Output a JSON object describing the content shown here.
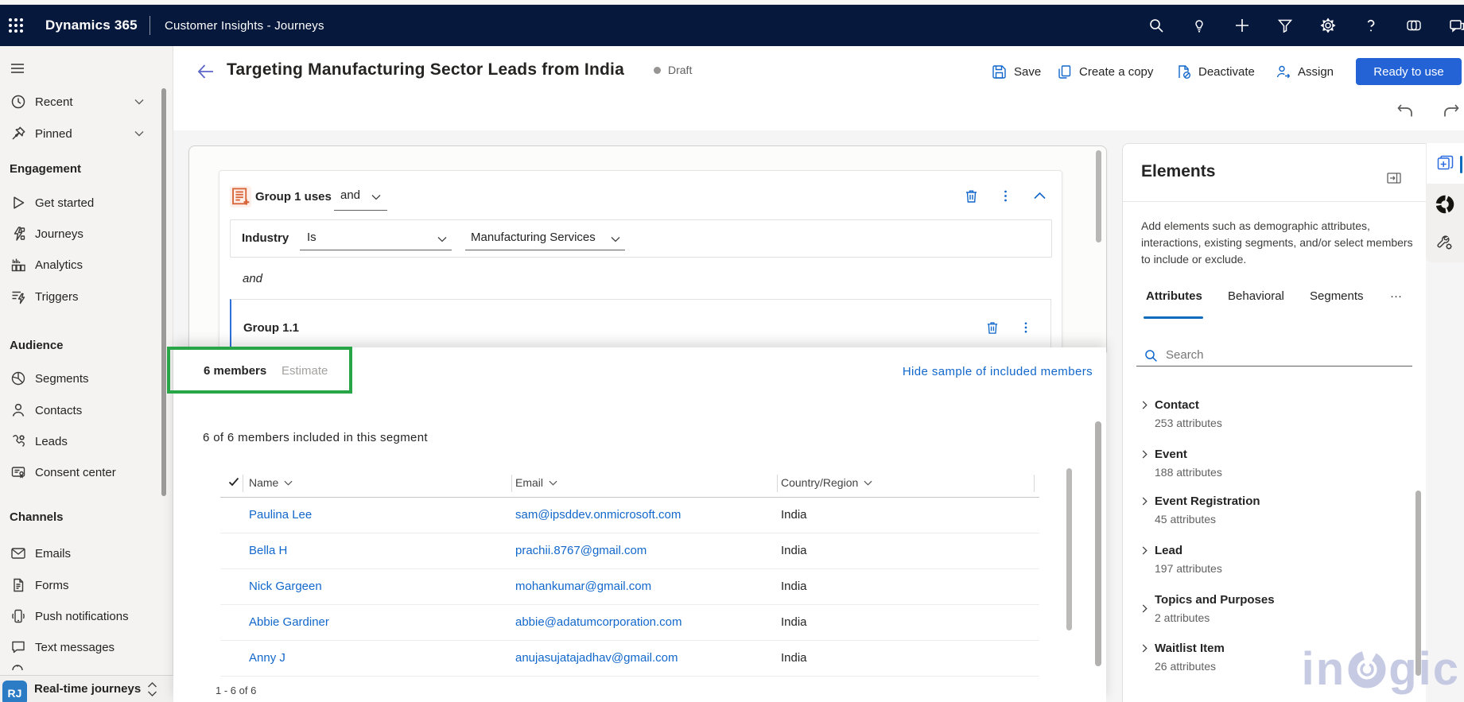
{
  "topbar": {
    "brand": "Dynamics 365",
    "app_name": "Customer Insights - Journeys",
    "icons": [
      "app-launcher-icon",
      "search-icon",
      "lightbulb-icon",
      "plus-icon",
      "filter-icon",
      "gear-icon",
      "help-icon",
      "copilot-icon",
      "feedback-icon"
    ]
  },
  "sidebar": {
    "collapse": "menu-icon",
    "top_items": [
      {
        "label": "Recent",
        "icon": "clock-icon"
      },
      {
        "label": "Pinned",
        "icon": "pin-icon"
      }
    ],
    "sections": [
      {
        "header": "Engagement",
        "items": [
          {
            "label": "Get started",
            "icon": "play-icon"
          },
          {
            "label": "Journeys",
            "icon": "journeys-icon"
          },
          {
            "label": "Analytics",
            "icon": "analytics-icon"
          },
          {
            "label": "Triggers",
            "icon": "triggers-icon"
          }
        ]
      },
      {
        "header": "Audience",
        "items": [
          {
            "label": "Segments",
            "icon": "segments-icon"
          },
          {
            "label": "Contacts",
            "icon": "person-icon"
          },
          {
            "label": "Leads",
            "icon": "leads-icon"
          },
          {
            "label": "Consent center",
            "icon": "consent-icon"
          }
        ]
      },
      {
        "header": "Channels",
        "items": [
          {
            "label": "Emails",
            "icon": "envelope-icon"
          },
          {
            "label": "Forms",
            "icon": "form-icon"
          },
          {
            "label": "Push notifications",
            "icon": "push-icon"
          },
          {
            "label": "Text messages",
            "icon": "message-icon"
          }
        ]
      }
    ],
    "area_switcher": {
      "initials": "RJ",
      "label": "Real-time journeys"
    }
  },
  "header": {
    "back": "back-arrow-icon",
    "title": "Targeting Manufacturing Sector Leads from India",
    "status": "Draft",
    "commands": [
      {
        "label": "Save",
        "icon": "save-icon"
      },
      {
        "label": "Create a copy",
        "icon": "copy-icon"
      },
      {
        "label": "Deactivate",
        "icon": "deactivate-icon"
      },
      {
        "label": "Assign",
        "icon": "assign-icon"
      }
    ],
    "primary_button": "Ready to use"
  },
  "builder": {
    "group_title": "Group 1 uses",
    "group_operator": "and",
    "condition": {
      "attribute": "Industry",
      "operator": "Is",
      "value": "Manufacturing Services"
    },
    "joiner": "and",
    "subgroup_title": "Group 1.1"
  },
  "members_panel": {
    "tabs": [
      {
        "label": "6 members",
        "active": true
      },
      {
        "label": "Estimate",
        "active": false
      }
    ],
    "hide_link": "Hide sample of included members",
    "summary": "6 of 6 members included in this segment",
    "table": {
      "columns": [
        "Name",
        "Email",
        "Country/Region"
      ],
      "rows": [
        {
          "name": "Paulina Lee",
          "email": "sam@ipsddev.onmicrosoft.com",
          "country": "India"
        },
        {
          "name": "Bella H",
          "email": "prachii.8767@gmail.com",
          "country": "India"
        },
        {
          "name": "Nick Gargeen",
          "email": "mohankumar@gmail.com",
          "country": "India"
        },
        {
          "name": "Abbie Gardiner",
          "email": "abbie@adatumcorporation.com",
          "country": "India"
        },
        {
          "name": "Anny J",
          "email": "anujasujatajadhav@gmail.com",
          "country": "India"
        }
      ],
      "pagination": "1 - 6 of 6"
    }
  },
  "elements_panel": {
    "title": "Elements",
    "description": "Add elements such as demographic attributes, interactions, existing segments, and/or select members to include or exclude.",
    "tabs": [
      {
        "label": "Attributes",
        "active": true
      },
      {
        "label": "Behavioral",
        "active": false
      },
      {
        "label": "Segments",
        "active": false
      }
    ],
    "more_tab": "···",
    "search_placeholder": "Search",
    "attributes": [
      {
        "name": "Contact",
        "count": "253 attributes"
      },
      {
        "name": "Event",
        "count": "188 attributes"
      },
      {
        "name": "Event Registration",
        "count": "45 attributes"
      },
      {
        "name": "Lead",
        "count": "197 attributes"
      },
      {
        "name": "Topics and Purposes",
        "count": "2 attributes"
      },
      {
        "name": "Waitlist Item",
        "count": "26 attributes"
      }
    ]
  },
  "watermark": {
    "prefix": "in",
    "suffix": "gic"
  },
  "annotation_color": "#28a546",
  "colors": {
    "accent_blue": "#1267cb",
    "primary_button": "#2463d6",
    "topbar_navy": "#06183c",
    "tab_underline": "#0f6cbd"
  }
}
